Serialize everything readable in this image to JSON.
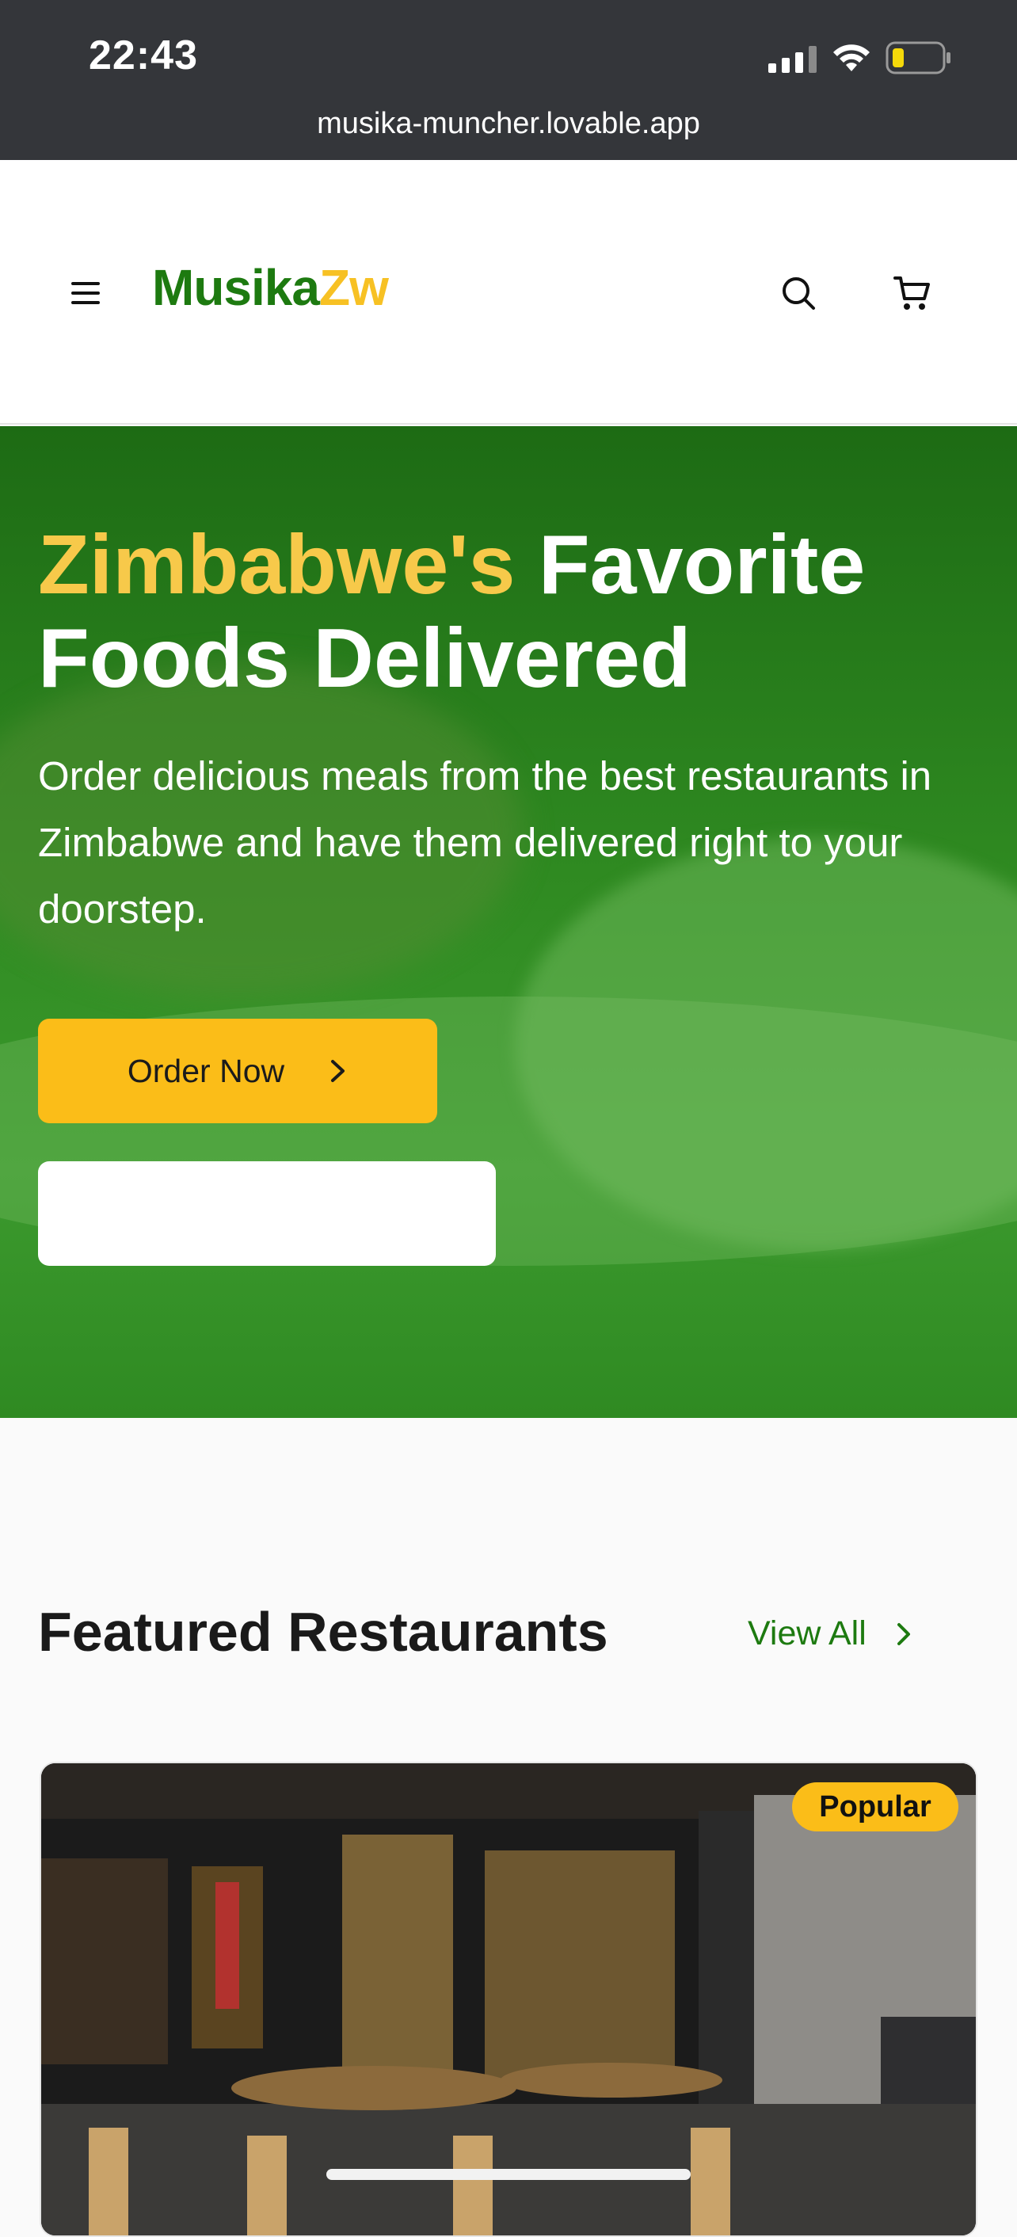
{
  "status_bar": {
    "time": "22:43",
    "url": "musika-muncher.lovable.app"
  },
  "header": {
    "logo_part1": "Musika",
    "logo_part2": "Zw",
    "icons": [
      "menu-icon",
      "search-icon",
      "cart-icon"
    ]
  },
  "hero": {
    "title_highlight": "Zimbabwe's",
    "title_rest_line1": "Favorite",
    "title_line2": "Foods Delivered",
    "subtitle": "Order delicious meals from the best restaurants in Zimbabwe and have them delivered right to your doorstep.",
    "order_button": "Order Now"
  },
  "featured": {
    "title": "Featured Restaurants",
    "view_all": "View All",
    "card_badge": "Popular"
  },
  "colors": {
    "brand_green": "#1d7a10",
    "brand_yellow": "#f7c124",
    "button_yellow": "#fbbd18",
    "hero_green": "#2f8a21"
  }
}
